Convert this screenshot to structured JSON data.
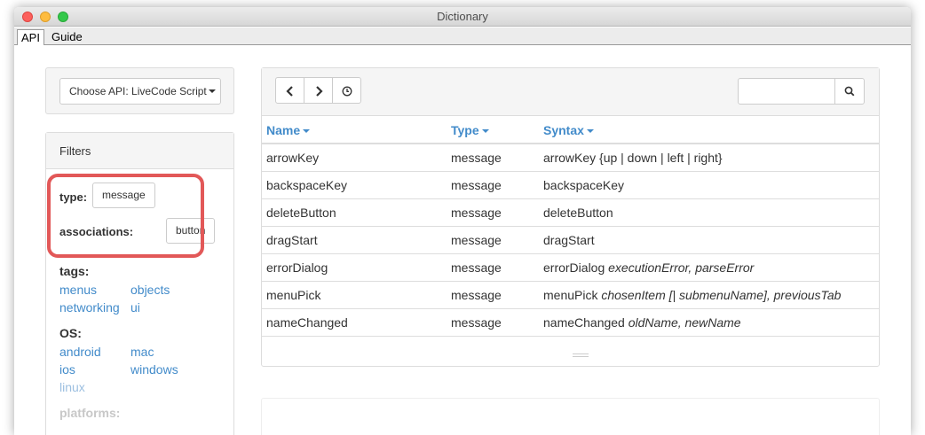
{
  "window": {
    "title": "Dictionary"
  },
  "tabs": [
    {
      "label": "API",
      "active": true
    },
    {
      "label": "Guide",
      "active": false
    }
  ],
  "api_selector": {
    "label": "Choose API: LiveCode Script"
  },
  "filters": {
    "heading": "Filters",
    "type": {
      "label": "type:",
      "value": "message"
    },
    "associations": {
      "label": "associations:",
      "value": "button"
    },
    "tags": {
      "label": "tags:",
      "items": [
        "menus",
        "objects",
        "networking",
        "ui"
      ]
    },
    "os": {
      "label": "OS:",
      "items": [
        "android",
        "mac",
        "ios",
        "windows",
        "linux"
      ]
    },
    "platforms": {
      "label": "platforms:"
    }
  },
  "toolbar": {
    "back_icon": "chevron-left-icon",
    "forward_icon": "chevron-right-icon",
    "history_icon": "clock-icon",
    "search_placeholder": "",
    "search_icon": "search-icon"
  },
  "table": {
    "headers": [
      "Name",
      "Type",
      "Syntax"
    ],
    "rows": [
      {
        "name": "arrowKey",
        "type": "message",
        "syntax": "arrowKey {up | down | left | right}",
        "params": ""
      },
      {
        "name": "backspaceKey",
        "type": "message",
        "syntax": "backspaceKey",
        "params": ""
      },
      {
        "name": "deleteButton",
        "type": "message",
        "syntax": "deleteButton",
        "params": ""
      },
      {
        "name": "dragStart",
        "type": "message",
        "syntax": "dragStart",
        "params": ""
      },
      {
        "name": "errorDialog",
        "type": "message",
        "syntax": "errorDialog ",
        "params": "executionError, parseError"
      },
      {
        "name": "menuPick",
        "type": "message",
        "syntax": "menuPick ",
        "params": "chosenItem [| submenuName], previousTab"
      },
      {
        "name": "nameChanged",
        "type": "message",
        "syntax": "nameChanged ",
        "params": "oldName, newName"
      }
    ]
  },
  "colors": {
    "accent": "#428bca",
    "highlight": "#e25858"
  }
}
